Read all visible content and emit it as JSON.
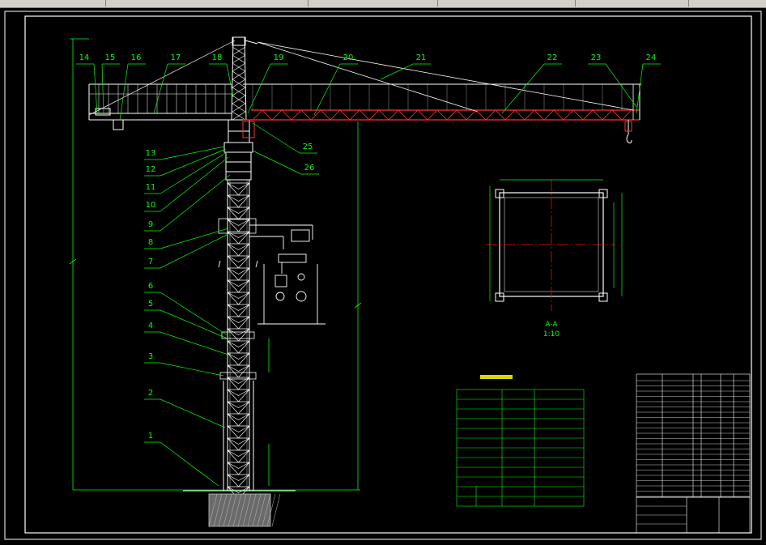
{
  "callouts": [
    {
      "n": "14"
    },
    {
      "n": "15"
    },
    {
      "n": "16"
    },
    {
      "n": "17"
    },
    {
      "n": "18"
    },
    {
      "n": "19"
    },
    {
      "n": "20"
    },
    {
      "n": "21"
    },
    {
      "n": "22"
    },
    {
      "n": "23"
    },
    {
      "n": "24"
    },
    {
      "n": "25"
    },
    {
      "n": "26"
    },
    {
      "n": "13"
    },
    {
      "n": "12"
    },
    {
      "n": "11"
    },
    {
      "n": "10"
    },
    {
      "n": "9"
    },
    {
      "n": "8"
    },
    {
      "n": "7"
    },
    {
      "n": "6"
    },
    {
      "n": "5"
    },
    {
      "n": "4"
    },
    {
      "n": "3"
    },
    {
      "n": "2"
    },
    {
      "n": "1"
    }
  ],
  "section": {
    "name": "A-A",
    "scale": "1:10"
  },
  "colors": {
    "background": "#000000",
    "frame": "#ffffff",
    "leader": "#00ff00",
    "structure": "#ffffff",
    "jib_chord": "#ff3030",
    "centerline": "#ff0000",
    "dimension": "#00ff00",
    "table_title": "#ffff00",
    "hydraulic": "#ffffff",
    "toolbar": "#d4d0c8"
  }
}
